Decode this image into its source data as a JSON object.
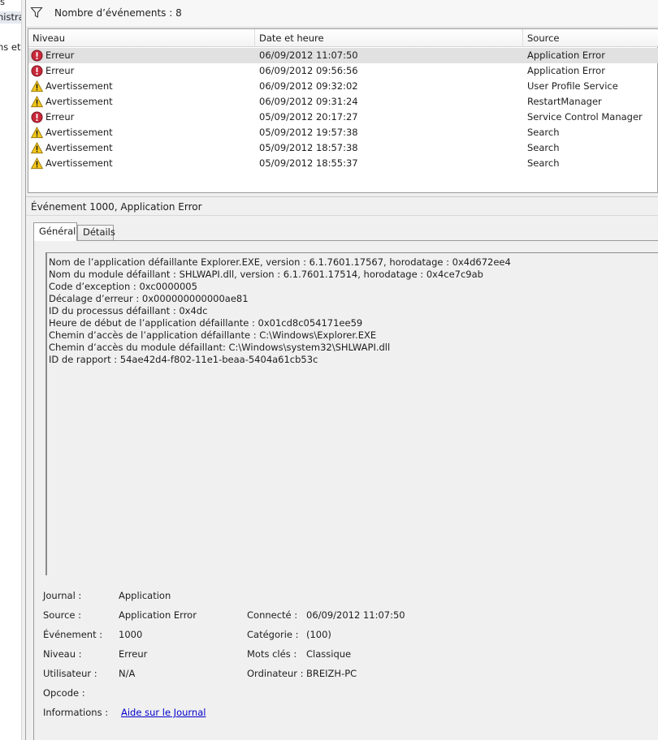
{
  "left_pane": {
    "lines": [
      "s",
      "nistra",
      "ns et"
    ]
  },
  "filter_bar": {
    "icon": "filter-icon",
    "label": "Nombre d’événements : 8"
  },
  "events_table": {
    "columns": [
      "Niveau",
      "Date et heure",
      "Source"
    ],
    "rows": [
      {
        "level": "Erreur",
        "icon": "error-icon",
        "datetime": "06/09/2012 11:07:50",
        "source": "Application Error",
        "selected": true
      },
      {
        "level": "Erreur",
        "icon": "error-icon",
        "datetime": "06/09/2012 09:56:56",
        "source": "Application Error"
      },
      {
        "level": "Avertissement",
        "icon": "warning-icon",
        "datetime": "06/09/2012 09:32:02",
        "source": "User Profile Service"
      },
      {
        "level": "Avertissement",
        "icon": "warning-icon",
        "datetime": "06/09/2012 09:31:24",
        "source": "RestartManager"
      },
      {
        "level": "Erreur",
        "icon": "error-icon",
        "datetime": "05/09/2012 20:17:27",
        "source": "Service Control Manager"
      },
      {
        "level": "Avertissement",
        "icon": "warning-icon",
        "datetime": "05/09/2012 19:57:38",
        "source": "Search"
      },
      {
        "level": "Avertissement",
        "icon": "warning-icon",
        "datetime": "05/09/2012 18:57:38",
        "source": "Search"
      },
      {
        "level": "Avertissement",
        "icon": "warning-icon",
        "datetime": "05/09/2012 18:55:37",
        "source": "Search"
      }
    ]
  },
  "detail": {
    "title": "Événement 1000, Application Error",
    "tabs": [
      "Général",
      "Détails"
    ],
    "description_lines": [
      "Nom de l’application défaillante Explorer.EXE, version : 6.1.7601.17567, horodatage : 0x4d672ee4",
      "Nom du module défaillant : SHLWAPI.dll, version : 6.1.7601.17514, horodatage : 0x4ce7c9ab",
      "Code d’exception : 0xc0000005",
      "Décalage d’erreur : 0x000000000000ae81",
      "ID du processus défaillant : 0x4dc",
      "Heure de début de l’application défaillante : 0x01cd8c054171ee59",
      "Chemin d’accès de l’application défaillante : C:\\Windows\\Explorer.EXE",
      "Chemin d’accès du module défaillant: C:\\Windows\\system32\\SHLWAPI.dll",
      "ID de rapport : 54ae42d4-f802-11e1-beaa-5404a61cb53c"
    ],
    "properties": {
      "journal_label": "Journal :",
      "journal_value": "Application",
      "source_label": "Source :",
      "source_value": "Application Error",
      "connecte_label": "Connecté :",
      "connecte_value": "06/09/2012 11:07:50",
      "evenement_label": "Événement :",
      "evenement_value": "1000",
      "categorie_label": "Catégorie :",
      "categorie_value": "(100)",
      "niveau_label": "Niveau :",
      "niveau_value": "Erreur",
      "motscles_label": "Mots clés :",
      "motscles_value": "Classique",
      "utilisateur_label": "Utilisateur :",
      "utilisateur_value": "N/A",
      "ordinateur_label": "Ordinateur :",
      "ordinateur_value": "BREIZH-PC",
      "opcode_label": "Opcode :",
      "informations_label": "Informations :",
      "informations_link": "Aide sur le Journal"
    }
  }
}
